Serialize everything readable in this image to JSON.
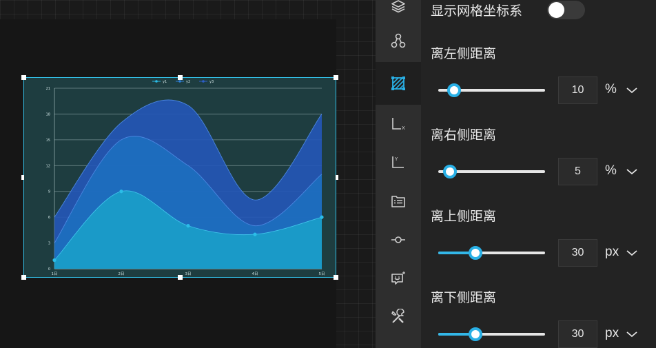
{
  "panel": {
    "show_grid_label": "显示网格坐标系",
    "show_grid_on": false,
    "margins": [
      {
        "label": "离左侧距离",
        "value": "10",
        "unit": "%",
        "level": 0.1
      },
      {
        "label": "离右侧距离",
        "value": "5",
        "unit": "%",
        "level": 0.05
      },
      {
        "label": "离上侧距离",
        "value": "30",
        "unit": "px",
        "level": 0.3
      },
      {
        "label": "离下侧距离",
        "value": "30",
        "unit": "px",
        "level": 0.3
      }
    ]
  },
  "rail": {
    "items": [
      "layers-icon",
      "nodes-icon",
      "grid-area-icon",
      "x-axis-icon",
      "y-axis-icon",
      "list-icon",
      "point-line-icon",
      "tooltip-icon",
      "tools-icon"
    ],
    "active": "grid-area-icon"
  },
  "colors": {
    "accent": "#29b0e6",
    "y1": "#1a9dc8",
    "y2": "#1d6fbf",
    "y3": "#2456b8"
  },
  "chart_data": {
    "type": "area",
    "legend": [
      "y1",
      "y2",
      "y3"
    ],
    "categories": [
      "1日",
      "2日",
      "3日",
      "4日",
      "5日"
    ],
    "ylim": [
      0,
      21
    ],
    "yticks": [
      "0",
      "3",
      "6",
      "9",
      "12",
      "15",
      "18",
      "21"
    ],
    "series": [
      {
        "name": "y1",
        "values": [
          1,
          9,
          5,
          4,
          6
        ]
      },
      {
        "name": "y2",
        "values": [
          3,
          15,
          12,
          5,
          11
        ]
      },
      {
        "name": "y3",
        "values": [
          6,
          17,
          19,
          8,
          18
        ]
      }
    ]
  }
}
